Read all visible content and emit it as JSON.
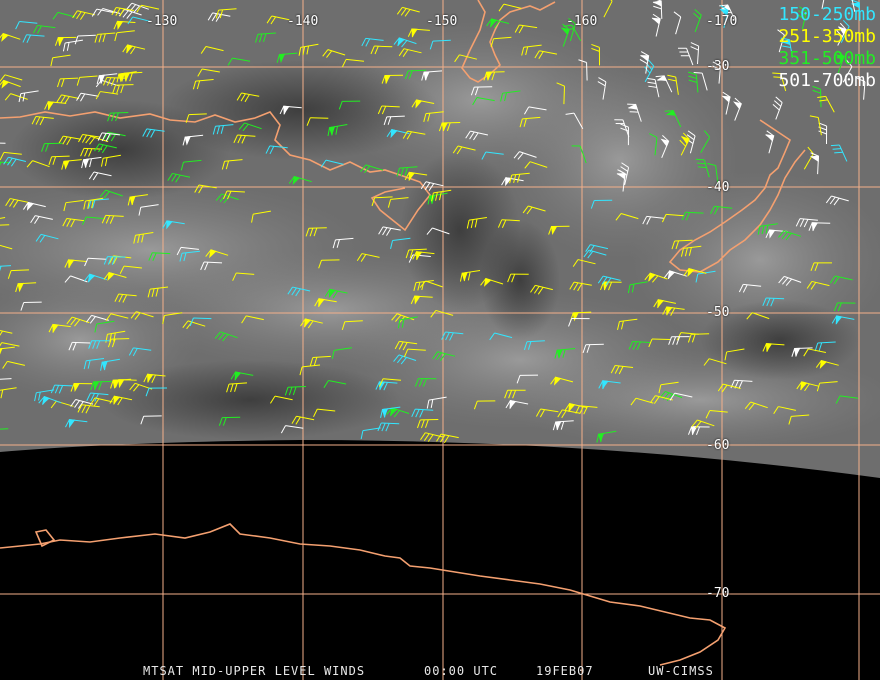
{
  "legend": [
    {
      "label": "150-250mb",
      "color": "#33e6ff"
    },
    {
      "label": "251-350mb",
      "color": "#ffff00"
    },
    {
      "label": "351-500mb",
      "color": "#22ee22"
    },
    {
      "label": "501-700mb",
      "color": "#ffffff"
    }
  ],
  "longitude_labels": [
    "-130",
    "-140",
    "-150",
    "-160",
    "-170"
  ],
  "latitude_labels": [
    "-30",
    "-40",
    "-50",
    "-60",
    "-70"
  ],
  "footer": {
    "product": "MTSAT MID-UPPER LEVEL WINDS",
    "time": "00:00 UTC",
    "date": "19FEB07",
    "source": "UW-CIMSS"
  },
  "colors": {
    "grid": "#f4b08a",
    "coast": "#f4a070",
    "space": "#000000"
  }
}
